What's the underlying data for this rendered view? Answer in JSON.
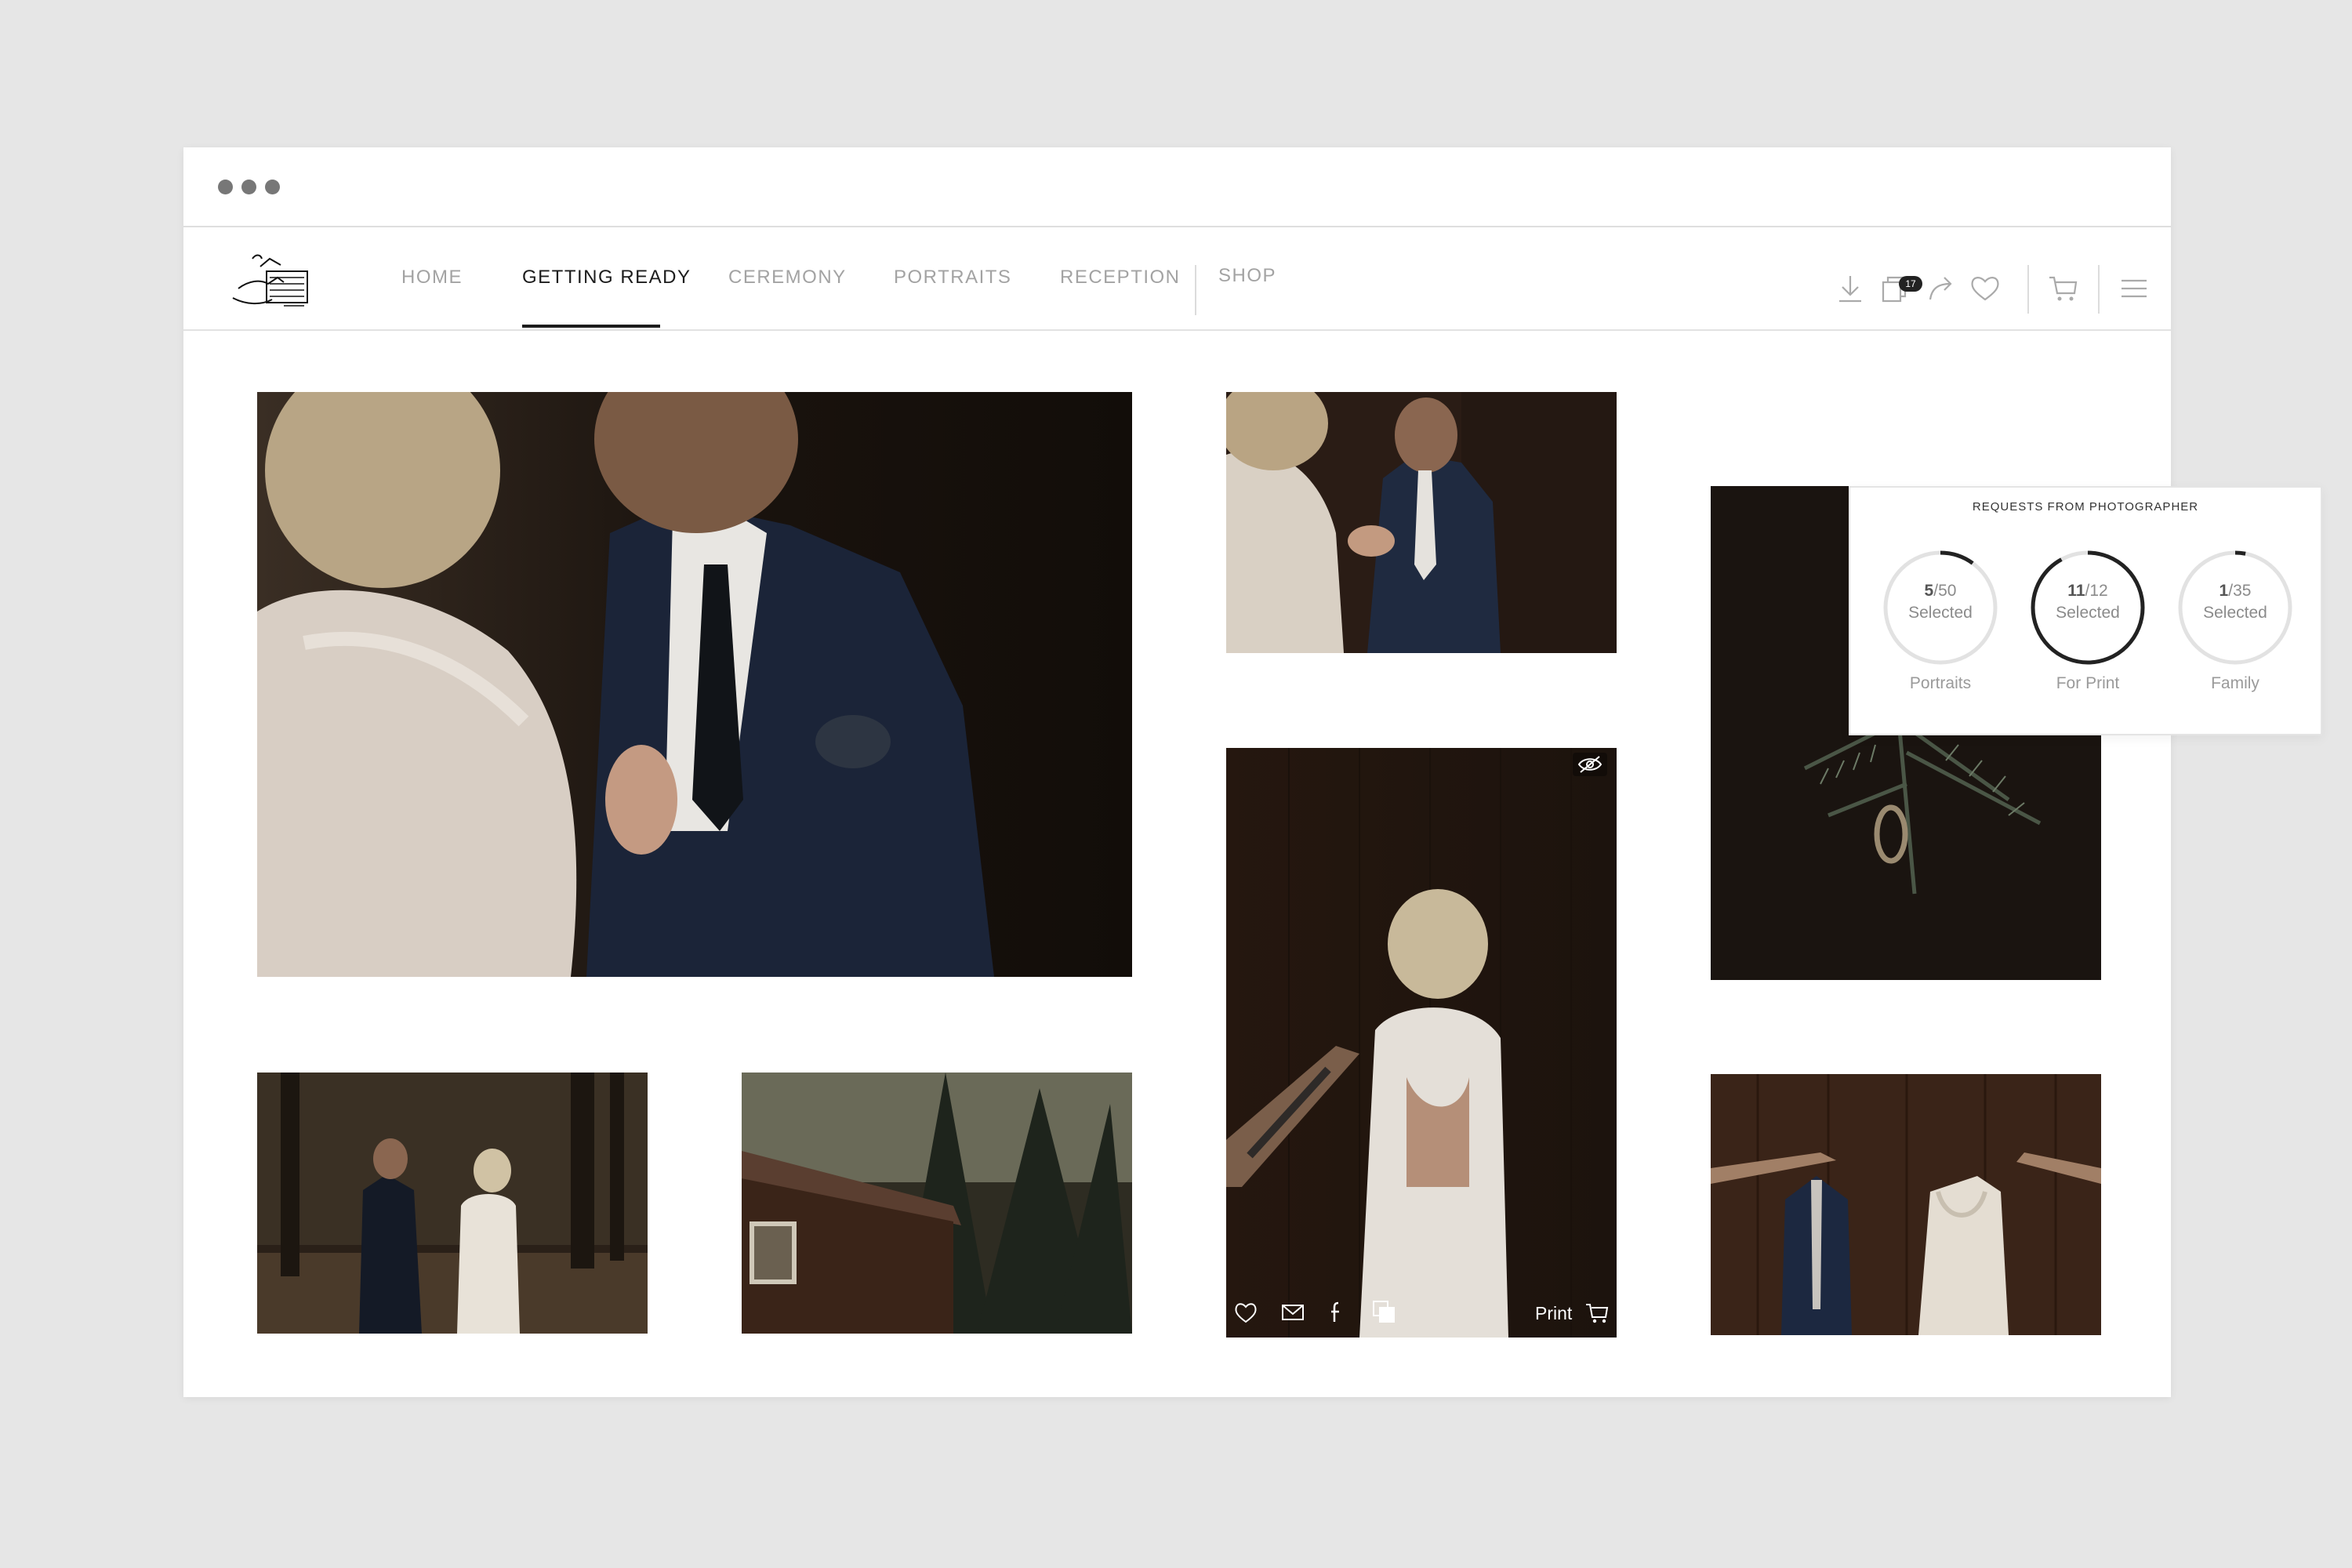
{
  "navigation": {
    "logo_name": "studio-logo",
    "items": [
      {
        "label": "HOME",
        "active": false
      },
      {
        "label": "GETTING READY",
        "active": true
      },
      {
        "label": "CEREMONY",
        "active": false
      },
      {
        "label": "PORTRAITS",
        "active": false
      },
      {
        "label": "RECEPTION",
        "active": false
      },
      {
        "label": "SHOP",
        "active": false
      }
    ],
    "actions": [
      "download-icon",
      "selection-icon",
      "share-icon",
      "heart-icon",
      "cart-icon",
      "menu-icon"
    ],
    "selection_badge": "17"
  },
  "requests_panel": {
    "title": "REQUESTS FROM PHOTOGRAPHER",
    "items": [
      {
        "selected": "5",
        "total": "/50",
        "status": "Selected",
        "label": "Portraits",
        "fraction": 0.1
      },
      {
        "selected": "11",
        "total": "/12",
        "status": "Selected",
        "label": "For Print",
        "fraction": 0.92
      },
      {
        "selected": "1",
        "total": "/35",
        "status": "Selected",
        "label": "Family",
        "fraction": 0.03
      }
    ]
  },
  "photo_overlay": {
    "actions": [
      "heart-icon",
      "mail-icon",
      "facebook-icon",
      "copy-icon"
    ],
    "print_label": "Print",
    "visibility_icon": "eye-hidden-icon"
  },
  "colors": {
    "page_background": "#e6e6e6",
    "window_background": "#ffffff",
    "active_text": "#1c1c1c",
    "inactive_text": "#a3a3a3",
    "ring_active": "#222222",
    "ring_track": "#e2e2e2"
  }
}
